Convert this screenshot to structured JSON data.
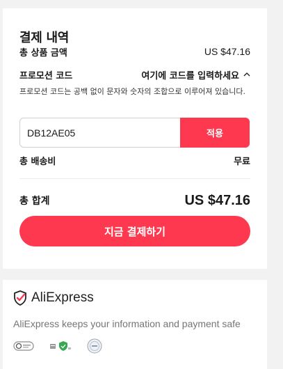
{
  "summary": {
    "title": "결제 내역",
    "subtotal_label": "총 상품 금액",
    "subtotal_value": "US $47.16",
    "promo_label": "프로모션 코드",
    "promo_link": "여기에 코드를 입력하세요",
    "promo_hint": "프로모션 코드는 공백 없이 문자와 숫자의 조합으로 이루어져 있습니다.",
    "promo_input_value": "DB12AE05",
    "apply_label": "적용",
    "shipping_label": "총 배송비",
    "shipping_value": "무료",
    "total_label": "총 합계",
    "total_value": "US $47.16",
    "pay_label": "지금 결제하기"
  },
  "trust": {
    "brand": "AliExpress",
    "safe_text": "AliExpress keeps your information and payment safe",
    "badge_icons": [
      "security-seal-icon",
      "verified-shield-icon",
      "certification-seal-icon"
    ]
  },
  "colors": {
    "accent": "#fd384f",
    "text": "#191919",
    "muted": "#757575",
    "page_bg": "#f2f2f2"
  }
}
